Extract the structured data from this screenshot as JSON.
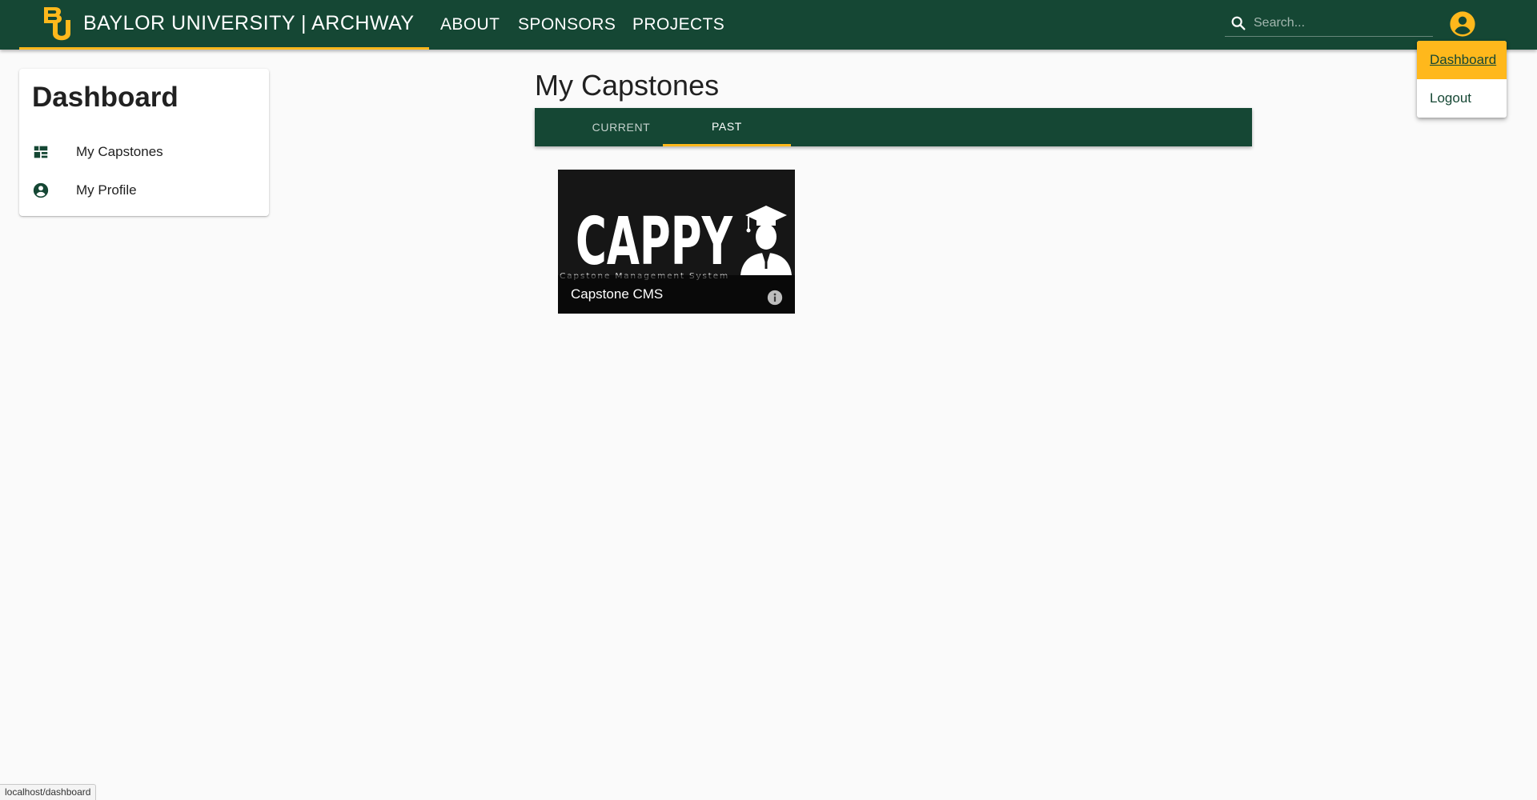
{
  "header": {
    "brand_title": "BAYLOR UNIVERSITY | ARCHWAY",
    "logo_icon": "baylor-bu-logo-icon",
    "nav": [
      {
        "label": "ABOUT"
      },
      {
        "label": "SPONSORS"
      },
      {
        "label": "PROJECTS"
      }
    ],
    "search_placeholder": "Search...",
    "search_value": ""
  },
  "account_menu": {
    "items": [
      {
        "label": "Dashboard",
        "active": true
      },
      {
        "label": "Logout",
        "active": false
      }
    ]
  },
  "sidebar": {
    "title": "Dashboard",
    "items": [
      {
        "label": "My Capstones",
        "icon": "dashboard-grid-icon"
      },
      {
        "label": "My Profile",
        "icon": "account-circle-icon"
      }
    ]
  },
  "main": {
    "title": "My Capstones",
    "tabs": [
      {
        "label": "CURRENT",
        "active": false
      },
      {
        "label": "PAST",
        "active": true
      }
    ],
    "projects": [
      {
        "name": "Capstone CMS",
        "image_text": "CAPPY",
        "image_subtext": "Capstone Management System"
      }
    ]
  },
  "status_url": "localhost/dashboard",
  "colors": {
    "primary": "#154734",
    "accent": "#ffb81c",
    "background": "#fafafa"
  }
}
